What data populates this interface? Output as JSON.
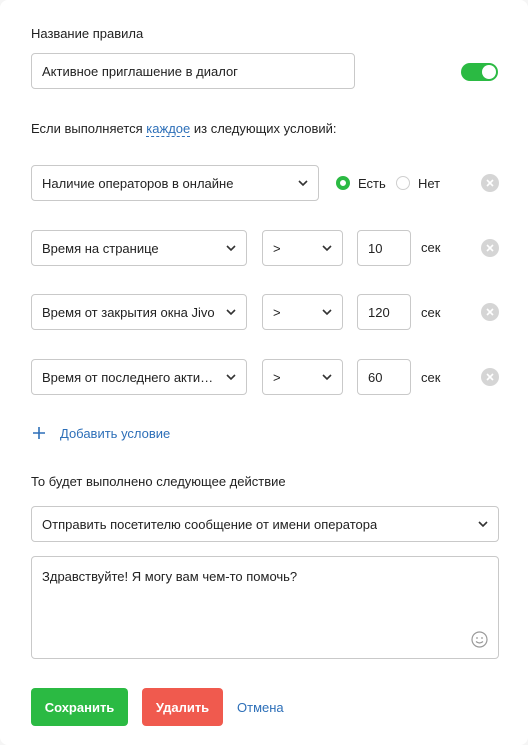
{
  "rule": {
    "name_label": "Название правила",
    "name_value": "Активное приглашение в диалог",
    "enabled": true
  },
  "conditions_header": {
    "prefix": "Если выполняется",
    "mode": "каждое",
    "suffix": "из следующих условий:"
  },
  "conditions": [
    {
      "type": "Наличие операторов в онлайне",
      "options": [
        "Есть",
        "Нет"
      ],
      "selected": "Есть"
    },
    {
      "type": "Время на странице",
      "operator": ">",
      "value": "10",
      "unit": "сек"
    },
    {
      "type": "Время от закрытия окна Jivo",
      "operator": ">",
      "value": "120",
      "unit": "сек"
    },
    {
      "type": "Время от последнего активн...",
      "operator": ">",
      "value": "60",
      "unit": "сек"
    }
  ],
  "add_condition_label": "Добавить условие",
  "action": {
    "label": "То будет выполнено следующее действие",
    "value": "Отправить посетителю сообщение от имени оператора",
    "message": "Здравствуйте! Я могу вам чем-то помочь?"
  },
  "buttons": {
    "save": "Сохранить",
    "delete": "Удалить",
    "cancel": "Отмена"
  },
  "colors": {
    "accent_green": "#2bba43",
    "danger_red": "#f05a4e",
    "link_blue": "#2d6fb8"
  }
}
